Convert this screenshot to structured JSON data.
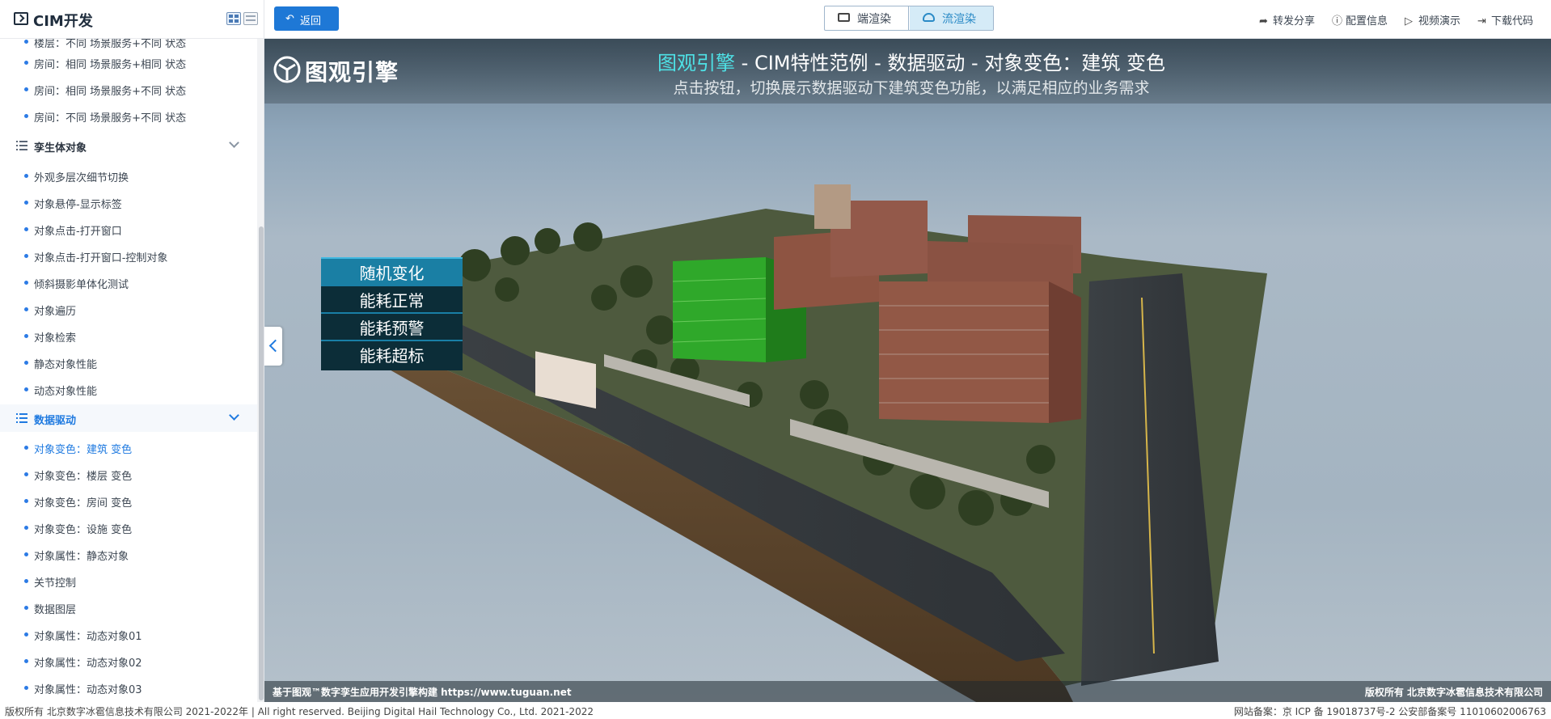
{
  "sidebar": {
    "title": "CIM开发",
    "partial_top": "楼层：不同 场景服务+不同 状态",
    "items_before": [
      "房间：相同 场景服务+相同 状态",
      "房间：相同 场景服务+不同 状态",
      "房间：不同 场景服务+不同 状态"
    ],
    "group1": {
      "label": "孪生体对象",
      "items": [
        "外观多层次细节切换",
        "对象悬停-显示标签",
        "对象点击-打开窗口",
        "对象点击-打开窗口-控制对象",
        "倾斜摄影单体化测试",
        "对象遍历",
        "对象检索",
        "静态对象性能",
        "动态对象性能"
      ]
    },
    "group2": {
      "label": "数据驱动",
      "items": [
        "对象变色：建筑 变色",
        "对象变色：楼层 变色",
        "对象变色：房间 变色",
        "对象变色：设施 变色",
        "对象属性：静态对象",
        "关节控制",
        "数据图层",
        "对象属性：动态对象01",
        "对象属性：动态对象02",
        "对象属性：动态对象03"
      ]
    }
  },
  "toolbar": {
    "back_label": "返回",
    "render_client": "端渲染",
    "render_stream": "流渲染",
    "share": "转发分享",
    "config": "配置信息",
    "video": "视频演示",
    "download": "下载代码"
  },
  "scene": {
    "brand": "图观引擎",
    "title_accent": "图观引擎",
    "title_rest": " - CIM特性范例 - 数据驱动 - 对象变色：建筑 变色",
    "subtitle": "点击按钮，切换展示数据驱动下建筑变色功能，以满足相应的业务需求",
    "buttons": [
      "随机变化",
      "能耗正常",
      "能耗预警",
      "能耗超标"
    ],
    "foot_left": "基于图观™数字孪生应用开发引擎构建 https://www.tuguan.net",
    "foot_right": "版权所有 北京数字冰雹信息技术有限公司",
    "colors": {
      "accent": "#4ee1e6",
      "active_button": "#1a7fa4",
      "button": "#0c2d38",
      "highlight_building": "#2fa82a"
    }
  },
  "footer": {
    "left": "版权所有 北京数字冰雹信息技术有限公司 2021-2022年 | All right reserved. Beijing Digital Hail Technology Co., Ltd. 2021-2022",
    "right": "网站备案：京 ICP 备 19018737号-2 公安部备案号 11010602006763"
  }
}
